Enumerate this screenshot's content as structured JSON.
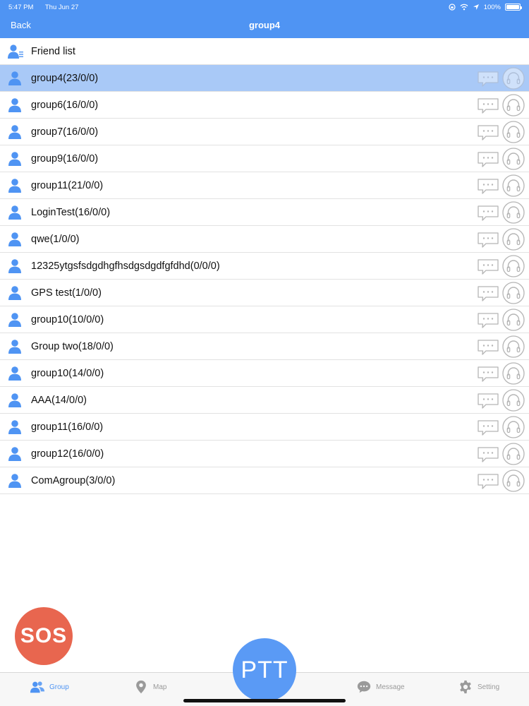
{
  "status_bar": {
    "time": "5:47 PM",
    "date": "Thu Jun 27",
    "battery": "100%"
  },
  "nav": {
    "back_label": "Back",
    "title": "group4"
  },
  "friend_list": {
    "label": "Friend list"
  },
  "groups": [
    {
      "label": "group4(23/0/0)",
      "selected": true
    },
    {
      "label": "group6(16/0/0)"
    },
    {
      "label": "group7(16/0/0)"
    },
    {
      "label": "group9(16/0/0)"
    },
    {
      "label": "group11(21/0/0)"
    },
    {
      "label": "LoginTest(16/0/0)"
    },
    {
      "label": "qwe(1/0/0)"
    },
    {
      "label": "12325ytgsfsdgdhgfhsdgsdgdfgfdhd(0/0/0)"
    },
    {
      "label": "GPS test(1/0/0)"
    },
    {
      "label": "group10(10/0/0)"
    },
    {
      "label": "Group two(18/0/0)"
    },
    {
      "label": "group10(14/0/0)"
    },
    {
      "label": "AAA(14/0/0)"
    },
    {
      "label": "group11(16/0/0)"
    },
    {
      "label": "group12(16/0/0)"
    },
    {
      "label": "ComAgroup(3/0/0)"
    }
  ],
  "sos": {
    "label": "SOS"
  },
  "ptt": {
    "label": "PTT"
  },
  "tabs": [
    {
      "key": "group",
      "label": "Group",
      "icon": "people-icon"
    },
    {
      "key": "map",
      "label": "Map",
      "icon": "map-pin-icon"
    },
    {
      "key": "message",
      "label": "Message",
      "icon": "chat-bubble-icon"
    },
    {
      "key": "setting",
      "label": "Setting",
      "icon": "gear-icon"
    }
  ],
  "colors": {
    "accent": "#4f94f3",
    "selected_row": "#a9c9f7",
    "sos": "#e8664f",
    "ptt": "#5a9af5",
    "icon_gray": "#b5b5b5"
  }
}
